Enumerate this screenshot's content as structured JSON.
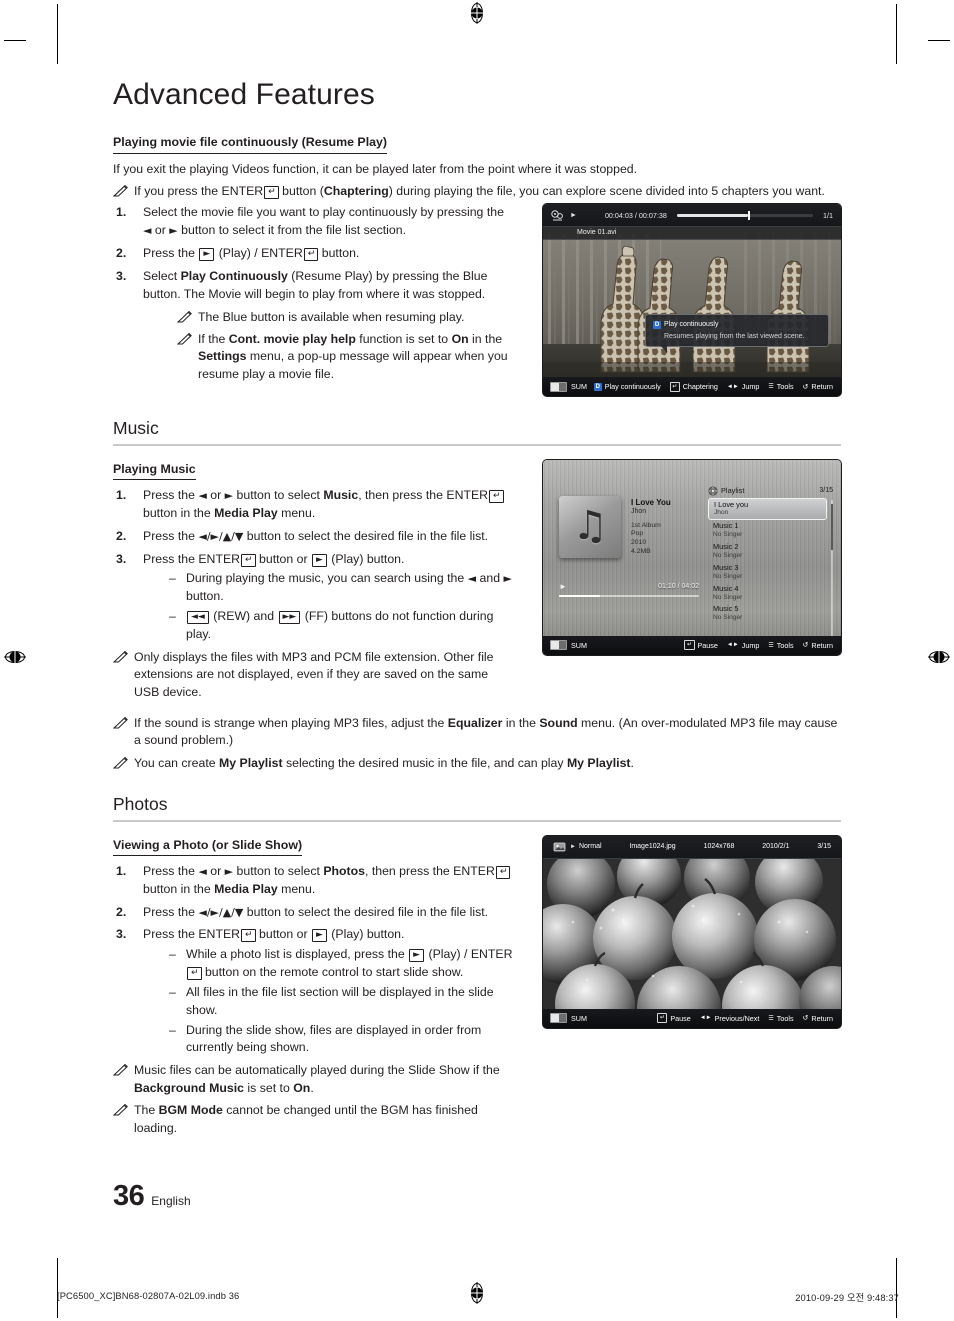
{
  "page": {
    "title": "Advanced Features",
    "number": "36",
    "language": "English"
  },
  "resume": {
    "heading": "Playing movie file continuously (Resume Play)",
    "intro": "If you exit the playing Videos function, it can be played later from the point where it was stopped.",
    "note1_a": "If you press the ENTER",
    "note1_b": " button (",
    "note1_bold": "Chaptering",
    "note1_c": ") during playing the file, you can explore scene divided into 5 chapters you want.",
    "steps": [
      {
        "num": "1.",
        "a": "Select the movie file you want to play continuously by pressing the ",
        "left_arrow": "◄",
        "b": " or ",
        "right_arrow": "►",
        "c": " button to select it from the file list section."
      },
      {
        "num": "2.",
        "a": "Press the ",
        "play": "►",
        "b": " (Play) / ENTER",
        "c": " button."
      },
      {
        "num": "3.",
        "a": "Select ",
        "bold": "Play Continuously",
        "b": " (Resume Play) by pressing the Blue button. The Movie will begin to play from where it was stopped."
      }
    ],
    "note2": "The Blue button is available when resuming play.",
    "note3_a": "If the ",
    "note3_b1": "Cont. movie play help",
    "note3_c": " function is set to ",
    "note3_b2": "On",
    "note3_d": " in the ",
    "note3_b3": "Settings",
    "note3_e": " menu, a pop-up message will appear when you resume play a movie file."
  },
  "movie_screen": {
    "time": "00:04:03 / 00:07:38",
    "count": "1/1",
    "filename": "Movie 01.avi",
    "tooltip_title": "Play continuously",
    "tooltip_badge": "D",
    "tooltip_body": "Resumes playing from the last viewed scene.",
    "usb_label": "SUM",
    "buttons": [
      {
        "badge": "D",
        "label": "Play continuously",
        "type": "blue"
      },
      {
        "badge": "↵",
        "label": "Chaptering",
        "type": "box"
      },
      {
        "badge": "◄►",
        "label": "Jump",
        "type": "plain"
      },
      {
        "badge": "☰",
        "label": "Tools",
        "type": "plain"
      },
      {
        "badge": "↺",
        "label": "Return",
        "type": "plain"
      }
    ]
  },
  "music": {
    "section": "Music",
    "sub": "Playing Music",
    "steps": [
      {
        "num": "1.",
        "a": "Press the ",
        "left_arrow": "◄",
        "b": " or ",
        "right_arrow": "►",
        "c": " button to select ",
        "bold1": "Music",
        "d": ", then press the ENTER",
        "e": " button in the ",
        "bold2": "Media Play",
        "f": " menu."
      },
      {
        "num": "2.",
        "a": "Press the ",
        "arrows": "◄/►/▲/▼",
        "b": " button to select the desired file in the file list."
      },
      {
        "num": "3.",
        "a": "Press the ENTER",
        "b": " button or ",
        "play": "►",
        "c": " (Play) button."
      }
    ],
    "dash1_a": "During playing the music, you can search using the ",
    "dash1_left": "◄",
    "dash1_b": " and ",
    "dash1_right": "►",
    "dash1_c": " button.",
    "dash2_rew": "◄◄",
    "dash2_a": " (REW) and ",
    "dash2_ff": "►►",
    "dash2_b": " (FF) buttons do not function during play.",
    "note1": "Only displays the files with MP3 and PCM file extension. Other file extensions are not displayed, even if they are saved on the same USB device.",
    "note2_a": "If the sound is strange when playing MP3 files, adjust the ",
    "note2_b1": "Equalizer",
    "note2_c": " in the ",
    "note2_b2": "Sound",
    "note2_d": " menu. (An over-modulated MP3 file may cause a sound problem.)",
    "note3_a": "You can create ",
    "note3_b1": "My Playlist",
    "note3_c": " selecting the desired music in the file, and can play ",
    "note3_b2": "My Playlist",
    "note3_d": "."
  },
  "music_screen": {
    "track_title": "I Love You",
    "track_artist": "Jhon",
    "album": "1st Album",
    "genre": "Pop",
    "year": "2010",
    "size": "4.2MB",
    "time": "01:10 / 04:02",
    "playlist_label": "Playlist",
    "playlist_count": "3/15",
    "playlist": [
      {
        "title": "I Love you",
        "artist": "Jhon",
        "selected": true
      },
      {
        "title": "Music 1",
        "artist": "No Singer",
        "selected": false
      },
      {
        "title": "Music 2",
        "artist": "No Singer",
        "selected": false
      },
      {
        "title": "Music 3",
        "artist": "No Singer",
        "selected": false
      },
      {
        "title": "Music 4",
        "artist": "No Singer",
        "selected": false
      },
      {
        "title": "Music 5",
        "artist": "No Singer",
        "selected": false
      }
    ],
    "usb_label": "SUM",
    "buttons": [
      {
        "badge": "↵",
        "label": "Pause",
        "type": "box"
      },
      {
        "badge": "◄►",
        "label": "Jump",
        "type": "plain"
      },
      {
        "badge": "☰",
        "label": "Tools",
        "type": "plain"
      },
      {
        "badge": "↺",
        "label": "Return",
        "type": "plain"
      }
    ]
  },
  "photos": {
    "section": "Photos",
    "sub": "Viewing a Photo (or Slide Show)",
    "steps": [
      {
        "num": "1.",
        "a": "Press the ",
        "left_arrow": "◄",
        "b": " or ",
        "right_arrow": "►",
        "c": " button to select ",
        "bold1": "Photos",
        "d": ", then press the ENTER",
        "e": " button in the ",
        "bold2": "Media Play",
        "f": " menu."
      },
      {
        "num": "2.",
        "a": "Press the ",
        "arrows": "◄/►/▲/▼",
        "b": " button to select the desired file in the file list."
      },
      {
        "num": "3.",
        "a": "Press the ENTER",
        "b": " button or ",
        "play": "►",
        "c": " (Play) button."
      }
    ],
    "dash1_a": "While a photo list is displayed, press the ",
    "dash1_play": "►",
    "dash1_b": " (Play) / ENTER",
    "dash1_c": " button on the remote control to start slide show.",
    "dash2": "All files in the file list section will be displayed in the slide show.",
    "dash3": "During the slide show, files are displayed in order from currently being shown.",
    "note1_a": "Music files can be automatically played during the Slide Show if the ",
    "note1_b1": "Background Music",
    "note1_c": " is set to ",
    "note1_b2": "On",
    "note1_d": ".",
    "note2_a": "The ",
    "note2_b1": "BGM Mode",
    "note2_c": " cannot be changed until the BGM has finished loading."
  },
  "photo_screen": {
    "mode": "Normal",
    "filename": "Image1024.jpg",
    "resolution": "1024x768",
    "date": "2010/2/1",
    "count": "3/15",
    "usb_label": "SUM",
    "buttons": [
      {
        "badge": "↵",
        "label": "Pause",
        "type": "box"
      },
      {
        "badge": "◄►",
        "label": "Previous/Next",
        "type": "plain"
      },
      {
        "badge": "☰",
        "label": "Tools",
        "type": "plain"
      },
      {
        "badge": "↺",
        "label": "Return",
        "type": "plain"
      }
    ]
  },
  "slug": {
    "left": "[PC6500_XC]BN68-02807A-02L09.indb   36",
    "right": "2010-09-29   오전 9:48:37"
  }
}
